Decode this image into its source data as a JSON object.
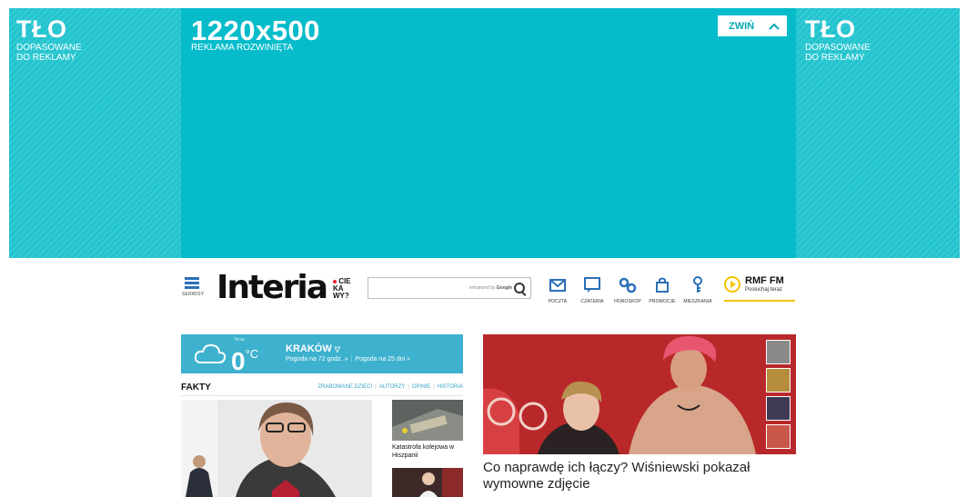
{
  "ad": {
    "left_title": "TŁO",
    "left_sub1": "DOPASOWANE",
    "left_sub2": "DO REKLAMY",
    "main_title": "1220x500",
    "main_sub": "REKLAMA ROZWINIĘTA",
    "collapse_label": "ZWIŃ",
    "right_title": "TŁO",
    "right_sub1": "DOPASOWANE",
    "right_sub2": "DO REKLAMY"
  },
  "header": {
    "menu_label": "SERWISY",
    "logo_text": "Interia",
    "tagline": [
      "CIE",
      "KA",
      "WY?"
    ],
    "search_powered_prefix": "enhanced by",
    "search_powered_brand": "Google",
    "services": [
      {
        "label": "POCZTA",
        "icon": "mail-icon"
      },
      {
        "label": "CZATERIA",
        "icon": "chat-icon"
      },
      {
        "label": "HOROSKOP",
        "icon": "horoscope-icon"
      },
      {
        "label": "PROMOCJE",
        "icon": "shopping-bag-icon"
      },
      {
        "label": "MIESZKANIA",
        "icon": "key-icon"
      }
    ],
    "radio_title": "RMF FM",
    "radio_sub": "Posłuchaj teraz"
  },
  "weather": {
    "small_label": "Teraz",
    "temp": "0",
    "unit": "°C",
    "city": "KRAKÓW",
    "link1": "Pogoda na 72 godz. »",
    "link2": "Pogoda na 25 dni »"
  },
  "fakty": {
    "title": "FAKTY",
    "links": [
      "ZRABOWANE DZIECI",
      "AUTORZY",
      "OPINIE",
      "HISTORIA"
    ],
    "side_caption": "Katastrofa kolejowa w Hiszpanii"
  },
  "story": {
    "title": "Co naprawdę ich łączy? Wiśniewski pokazał wymowne zdjęcie"
  },
  "colors": {
    "ad_teal": "#06bccb",
    "brand_blue": "#2c6fb7",
    "weather_blue": "#3db1ce",
    "rmf_yellow": "#f4c400"
  }
}
